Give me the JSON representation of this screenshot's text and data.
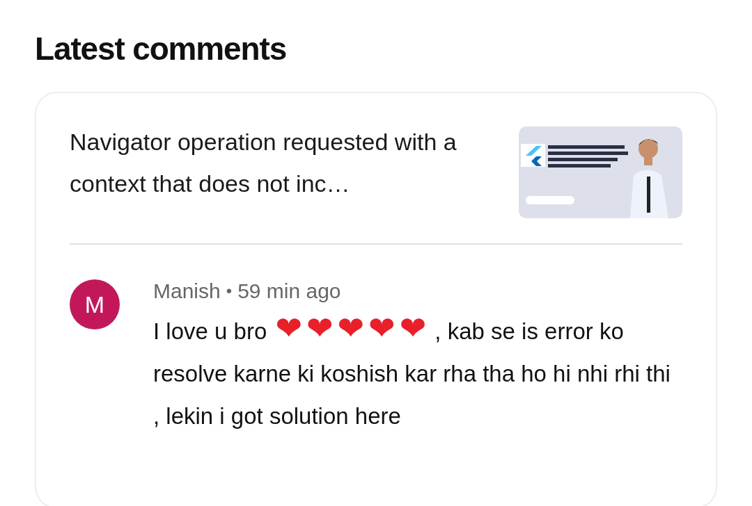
{
  "section_title": "Latest comments",
  "post": {
    "title": "Navigator operation requested with a context that does not inc…"
  },
  "comment": {
    "avatar_letter": "M",
    "author": "Manish",
    "separator": "•",
    "time": "59 min ago",
    "body_parts": [
      {
        "kind": "text",
        "text": "I love u bro "
      },
      {
        "kind": "emoji",
        "text": "❤"
      },
      {
        "kind": "emoji",
        "text": "❤"
      },
      {
        "kind": "emoji",
        "text": "❤"
      },
      {
        "kind": "emoji",
        "text": "❤"
      },
      {
        "kind": "emoji",
        "text": "❤"
      },
      {
        "kind": "text",
        "text": " , kab se is error ko resolve karne ki koshish kar rha tha ho hi nhi rhi thi , lekin i got solution here"
      }
    ]
  }
}
